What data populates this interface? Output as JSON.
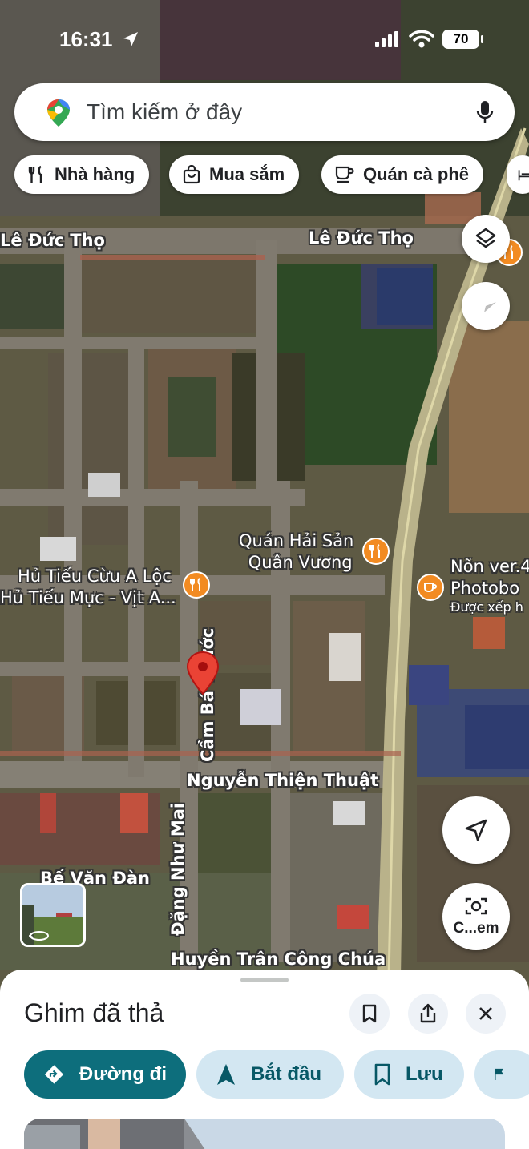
{
  "status_bar": {
    "time": "16:31",
    "battery": "70"
  },
  "search": {
    "placeholder": "Tìm kiếm ở đây"
  },
  "chips": [
    {
      "label": "Nhà hàng",
      "icon": "fork-knife-icon"
    },
    {
      "label": "Mua sắm",
      "icon": "shopping-bag-icon"
    },
    {
      "label": "Quán cà phê",
      "icon": "coffee-cup-icon"
    }
  ],
  "map": {
    "streets": {
      "le_duc_tho_left": "Lê Đức Thọ",
      "le_duc_tho_right": "Lê Đức Thọ",
      "cam_ba_thuoc": "Cầm Bá Thước",
      "nguyen_thien_thuat": "Nguyễn Thiện Thuật",
      "be_van_dan": "Bế Văn Đàn",
      "dang_nhu_mai": "Đặng Như Mai",
      "huyen_tran": "Huyền Trân Công Chúa"
    },
    "pois": {
      "hai_san_line1": "Quán Hải Sản",
      "hai_san_line2": "Quân Vương",
      "hu_tieu_line1": "Hủ Tiếu Cừu A Lộc",
      "hu_tieu_line2": "Hủ Tiếu Mực -  Vịt A...",
      "non_line1": "Nõn ver.4",
      "non_line2": "Photobo",
      "non_line3": "Được xếp h"
    },
    "street_view_icon": "rotate-360-icon"
  },
  "controls": {
    "camera_label": "C...em"
  },
  "sheet": {
    "title": "Ghim đã thả",
    "actions": {
      "directions": "Đường đi",
      "start": "Bắt đầu",
      "save": "Lưu"
    }
  },
  "colors": {
    "primary_action": "#0d6e7c",
    "secondary_action": "#d3e7f2",
    "pin_red": "#ea4335",
    "food_poi": "#f28b22"
  }
}
